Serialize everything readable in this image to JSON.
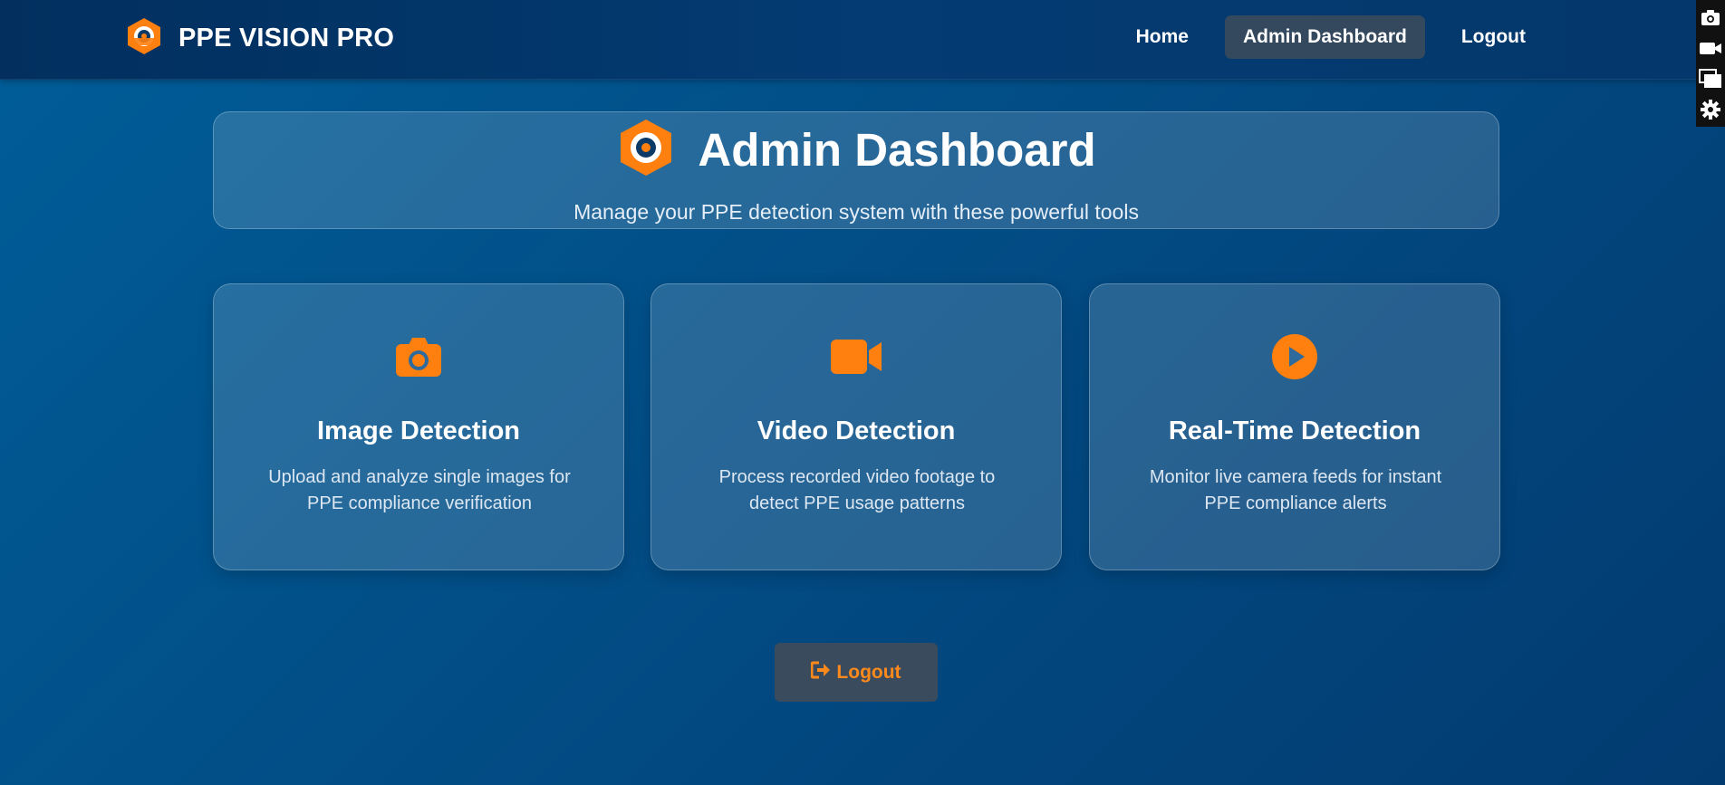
{
  "colors": {
    "accent": "#ff7f0f",
    "nav_active_bg": "#34495e",
    "logout_text": "#ff8a1c"
  },
  "brand": {
    "logo_icon": "hexagon-eye-logo-icon",
    "title": "PPE VISION PRO"
  },
  "nav": {
    "items": [
      {
        "label": "Home",
        "active": false
      },
      {
        "label": "Admin Dashboard",
        "active": true
      },
      {
        "label": "Logout",
        "active": false
      }
    ]
  },
  "side_tools": [
    "camera-icon",
    "video-camera-icon",
    "windows-icon",
    "gear-icon"
  ],
  "header": {
    "icon": "hexagon-eye-logo-icon",
    "title": "Admin Dashboard",
    "subtitle": "Manage your PPE detection system with these powerful tools"
  },
  "cards": [
    {
      "icon": "camera-icon",
      "title": "Image Detection",
      "description": "Upload and analyze single images for PPE compliance verification"
    },
    {
      "icon": "video-camera-icon",
      "title": "Video Detection",
      "description": "Process recorded video footage to detect PPE usage patterns"
    },
    {
      "icon": "play-circle-icon",
      "title": "Real-Time Detection",
      "description": "Monitor live camera feeds for instant PPE compliance alerts"
    }
  ],
  "logout_button": {
    "icon": "sign-out-icon",
    "label": "Logout"
  }
}
